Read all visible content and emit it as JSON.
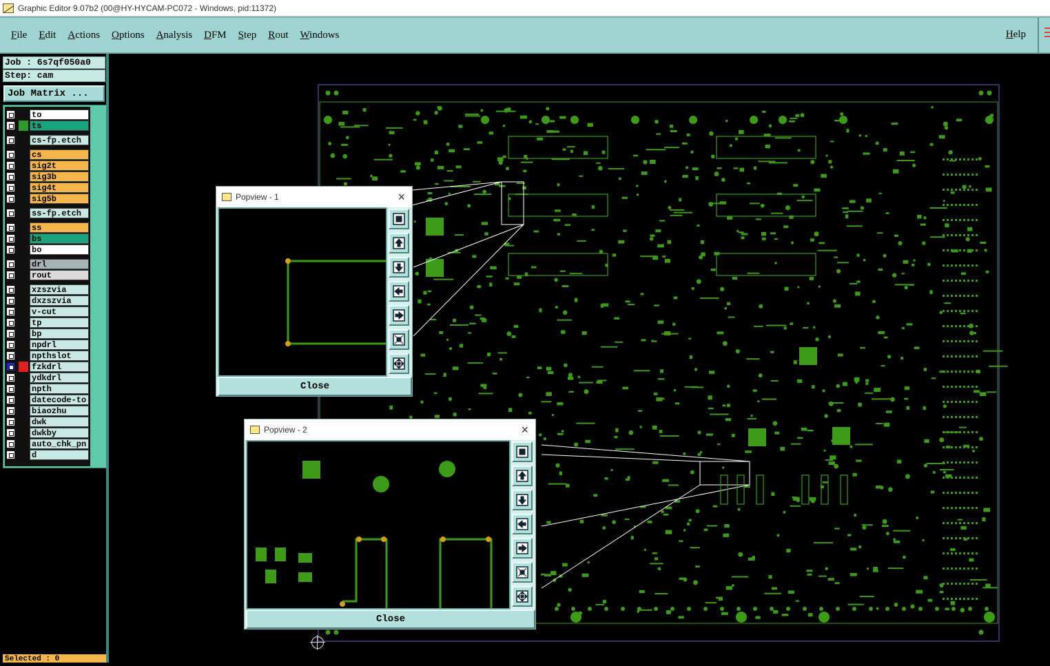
{
  "window": {
    "title": "Graphic Editor 9.07b2 (00@HY-HYCAM-PC072 - Windows, pid:11372)"
  },
  "menu": {
    "items": [
      "File",
      "Edit",
      "Actions",
      "Options",
      "Analysis",
      "DFM",
      "Step",
      "Rout",
      "Windows"
    ],
    "help": "Help"
  },
  "info": {
    "job": "Job : 6s7qf050a0",
    "step": "Step: cam",
    "job_matrix": "Job Matrix ..."
  },
  "layers": [
    {
      "name": "to",
      "color": "#ffffff",
      "swatch": ""
    },
    {
      "name": "ts",
      "color": "#1aa37a",
      "swatch": "#2e9a2e"
    },
    {
      "name": "cs-fp.etch",
      "color": "#c8e8e4",
      "swatch": ""
    },
    {
      "name": "cs",
      "color": "#f7b64c",
      "swatch": ""
    },
    {
      "name": "sig2t",
      "color": "#f7b64c",
      "swatch": ""
    },
    {
      "name": "sig3b",
      "color": "#f7b64c",
      "swatch": ""
    },
    {
      "name": "sig4t",
      "color": "#f7b64c",
      "swatch": ""
    },
    {
      "name": "sig5b",
      "color": "#f7b64c",
      "swatch": ""
    },
    {
      "name": "ss-fp.etch",
      "color": "#c8e8e4",
      "swatch": ""
    },
    {
      "name": "ss",
      "color": "#f7b64c",
      "swatch": ""
    },
    {
      "name": "bs",
      "color": "#1aa37a",
      "swatch": ""
    },
    {
      "name": "bo",
      "color": "#ffffff",
      "swatch": ""
    },
    {
      "name": "drl",
      "color": "#a6b4b8",
      "swatch": ""
    },
    {
      "name": "rout",
      "color": "#dadada",
      "swatch": ""
    },
    {
      "name": "xzszvia",
      "color": "#c8e8e4",
      "swatch": ""
    },
    {
      "name": "dxzszvia",
      "color": "#c8e8e4",
      "swatch": ""
    },
    {
      "name": "v-cut",
      "color": "#c8e8e4",
      "swatch": ""
    },
    {
      "name": "tp",
      "color": "#c8e8e4",
      "swatch": ""
    },
    {
      "name": "bp",
      "color": "#c8e8e4",
      "swatch": ""
    },
    {
      "name": "npdrl",
      "color": "#c8e8e4",
      "swatch": ""
    },
    {
      "name": "npthslot",
      "color": "#c8e8e4",
      "swatch": ""
    },
    {
      "name": "fzkdrl",
      "color": "#c8e8e4",
      "swatch": "#e02020",
      "active": true
    },
    {
      "name": "ydkdrl",
      "color": "#c8e8e4",
      "swatch": ""
    },
    {
      "name": "npth",
      "color": "#c8e8e4",
      "swatch": ""
    },
    {
      "name": "datecode-to",
      "color": "#c8e8e4",
      "swatch": ""
    },
    {
      "name": "biaozhu",
      "color": "#c8e8e4",
      "swatch": ""
    },
    {
      "name": "dwk",
      "color": "#c8e8e4",
      "swatch": ""
    },
    {
      "name": "dwkby",
      "color": "#c8e8e4",
      "swatch": ""
    },
    {
      "name": "auto_chk_pn",
      "color": "#c8e8e4",
      "swatch": ""
    },
    {
      "name": "d",
      "color": "#c8e8e4",
      "swatch": ""
    }
  ],
  "status": {
    "selected": "Selected : 0"
  },
  "popview1": {
    "title": "Popview - 1",
    "close": "Close"
  },
  "popview2": {
    "title": "Popview - 2",
    "close": "Close"
  },
  "toolbar_icons": [
    "zoom-fit-icon",
    "pan-up-icon",
    "pan-down-icon",
    "pan-left-icon",
    "pan-right-icon",
    "zoom-out-icon",
    "zoom-in-icon"
  ],
  "colors": {
    "menubar": "#9fd4d0",
    "pcb_green": "#3e9b1a",
    "pcb_outline": "#7a5cc0",
    "pad_orange": "#d4a017"
  }
}
